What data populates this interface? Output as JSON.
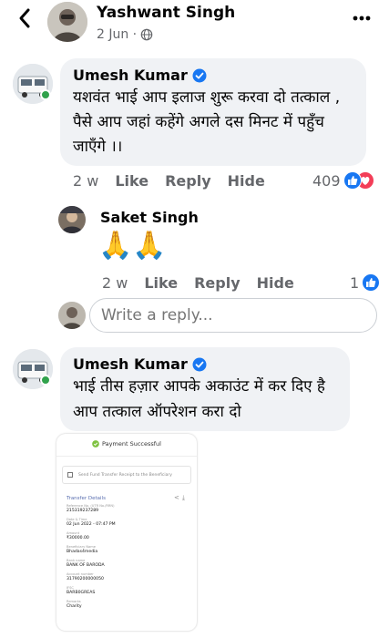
{
  "post": {
    "author": "Yashwant Singh",
    "date": "2 Jun ·"
  },
  "comments": [
    {
      "author": "Umesh Kumar",
      "lines": [
        "यशवंत भाई आप इलाज शुरू करवा दो तत्काल ,",
        "पैसे आप जहां कहेंगे अगले दस मिनट में पहुँच",
        "जाएँगे ।।"
      ],
      "time": "2 w",
      "like": "Like",
      "reply": "Reply",
      "hide": "Hide",
      "reaction_count": "409"
    },
    {
      "author": "Saket Singh",
      "emoji": "🙏🙏",
      "time": "2 w",
      "like": "Like",
      "reply": "Reply",
      "hide": "Hide",
      "reaction_count": "1"
    },
    {
      "author": "Umesh Kumar",
      "lines": [
        "भाई  तीस हज़ार आपके अकाउंट में कर दिए है",
        "आप तत्काल ऑपरेशन करा दो"
      ]
    }
  ],
  "reply_box": {
    "placeholder": "Write a reply..."
  },
  "receipt": {
    "status": "Payment Successful",
    "fund_transfer": "Send Fund Transfer Receipt to the Beneficiary",
    "details_title": "Transfer Details",
    "fields": [
      {
        "label": "Reference No. (UTR No./RRN)",
        "value": "215319237289"
      },
      {
        "label": "Date & Time",
        "value": "02 Jun 2022 - 07:47 PM"
      },
      {
        "label": "Amount",
        "value": "₹30000.00"
      },
      {
        "label": "Beneficiary Name",
        "value": "Bhadas4media"
      },
      {
        "label": "Bank name",
        "value": "BANK OF BARODA"
      },
      {
        "label": "Account number",
        "value": "31790200000050"
      },
      {
        "label": "IFSC",
        "value": "BARB0GREAS"
      },
      {
        "label": "Remarks",
        "value": "Charity"
      }
    ]
  },
  "colors": {
    "accent_blue": "#1877f2",
    "love_red": "#f33e58",
    "bubble_bg": "#f0f2f5",
    "meta_gray": "#65676b"
  }
}
